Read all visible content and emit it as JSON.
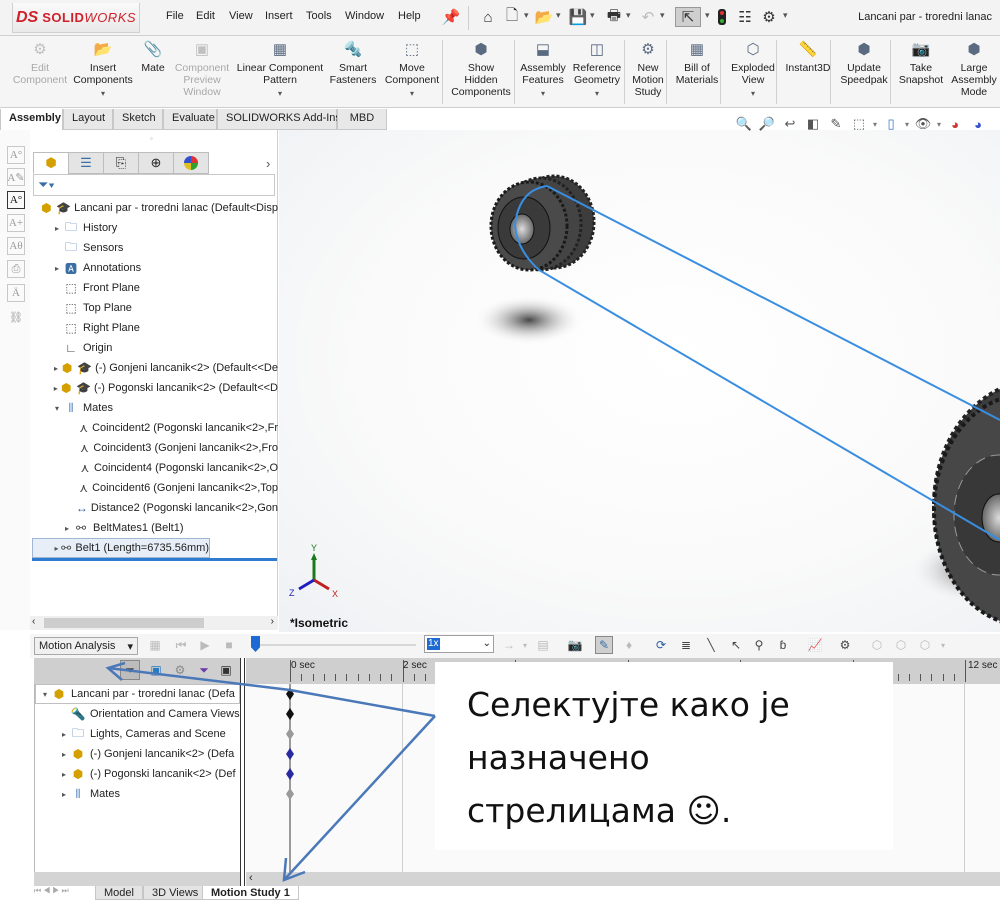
{
  "app": {
    "logo_prefix": "DS",
    "logo_text_bold": "SOLID",
    "logo_text_light": "WORKS",
    "document_title": "Lancani par - troredni lanac"
  },
  "menu": [
    "File",
    "Edit",
    "View",
    "Insert",
    "Tools",
    "Window",
    "Help"
  ],
  "quick_access": {
    "icons": [
      "pin-icon",
      "home-icon",
      "new-document-icon",
      "open-icon",
      "save-icon",
      "print-icon",
      "undo-icon",
      "select-icon",
      "rebuild-traffic-light-icon",
      "file-properties-icon",
      "options-gear-icon"
    ]
  },
  "command_manager": {
    "commands": [
      {
        "label": "Edit\nComponent",
        "icon": "edit-component-icon",
        "disabled": true
      },
      {
        "label": "Insert\nComponents",
        "icon": "insert-components-icon",
        "dropdown": true
      },
      {
        "label": "Mate",
        "icon": "mate-paperclip-icon"
      },
      {
        "label": "Component\nPreview\nWindow",
        "icon": "component-preview-icon",
        "disabled": true
      },
      {
        "label": "Linear Component\nPattern",
        "icon": "linear-pattern-icon",
        "dropdown": true
      },
      {
        "label": "Smart\nFasteners",
        "icon": "smart-fasteners-icon"
      },
      {
        "label": "Move\nComponent",
        "icon": "move-component-icon",
        "dropdown": true
      },
      {
        "label": "Show\nHidden\nComponents",
        "icon": "show-hidden-icon"
      },
      {
        "label": "Assembly\nFeatures",
        "icon": "assembly-features-icon",
        "dropdown": true
      },
      {
        "label": "Reference\nGeometry",
        "icon": "reference-geometry-icon",
        "dropdown": true
      },
      {
        "label": "New\nMotion\nStudy",
        "icon": "motion-study-icon"
      },
      {
        "label": "Bill of\nMaterials",
        "icon": "bom-icon"
      },
      {
        "label": "Exploded\nView",
        "icon": "exploded-view-icon",
        "dropdown": true
      },
      {
        "label": "Instant3D",
        "icon": "instant3d-icon"
      },
      {
        "label": "Update\nSpeedpak",
        "icon": "speedpak-icon"
      },
      {
        "label": "Take\nSnapshot",
        "icon": "camera-icon"
      },
      {
        "label": "Large\nAssembly\nMode",
        "icon": "large-assembly-icon"
      }
    ],
    "tabs": [
      "Assembly",
      "Layout",
      "Sketch",
      "Evaluate",
      "SOLIDWORKS Add-Ins",
      "MBD"
    ],
    "active_tab": "Assembly"
  },
  "feature_manager": {
    "tabs": [
      "featuremanager-tree-icon",
      "propertymanager-icon",
      "configurationmanager-icon",
      "dimxpert-icon",
      "display-manager-icon"
    ],
    "tree": [
      {
        "label": "Lancani par - troredni lanac  (Default<Disp",
        "level": 0,
        "icon": "assembly-icon",
        "expand": ""
      },
      {
        "label": "History",
        "level": 1,
        "icon": "history-folder-icon",
        "expand": "▸"
      },
      {
        "label": "Sensors",
        "level": 1,
        "icon": "sensors-folder-icon",
        "expand": ""
      },
      {
        "label": "Annotations",
        "level": 1,
        "icon": "annotations-folder-icon",
        "expand": "▸"
      },
      {
        "label": "Front Plane",
        "level": 1,
        "icon": "plane-icon",
        "expand": ""
      },
      {
        "label": "Top Plane",
        "level": 1,
        "icon": "plane-icon",
        "expand": ""
      },
      {
        "label": "Right Plane",
        "level": 1,
        "icon": "plane-icon",
        "expand": ""
      },
      {
        "label": "Origin",
        "level": 1,
        "icon": "origin-icon",
        "expand": ""
      },
      {
        "label": "(-) Gonjeni lancanik<2>  (Default<<De",
        "level": 1,
        "icon": "part-icon",
        "expand": "▸"
      },
      {
        "label": "(-) Pogonski lancanik<2>  (Default<<D",
        "level": 1,
        "icon": "part-icon",
        "expand": "▸"
      },
      {
        "label": "Mates",
        "level": 1,
        "icon": "mates-folder-icon",
        "expand": "▾"
      },
      {
        "label": "Coincident2 (Pogonski lancanik<2>,Fr",
        "level": 2,
        "icon": "coincident-mate-icon",
        "expand": ""
      },
      {
        "label": "Coincident3 (Gonjeni lancanik<2>,Fro",
        "level": 2,
        "icon": "coincident-mate-icon",
        "expand": ""
      },
      {
        "label": "Coincident4 (Pogonski lancanik<2>,O",
        "level": 2,
        "icon": "coincident-mate-icon",
        "expand": ""
      },
      {
        "label": "Coincident6 (Gonjeni lancanik<2>,Top",
        "level": 2,
        "icon": "coincident-mate-icon",
        "expand": ""
      },
      {
        "label": "Distance2 (Pogonski lancanik<2>,Gon",
        "level": 2,
        "icon": "distance-mate-icon",
        "expand": ""
      },
      {
        "label": "BeltMates1 (Belt1)",
        "level": 1.5,
        "icon": "belt-mates-icon",
        "expand": "▸"
      },
      {
        "label": "Belt1 (Length=6735.56mm)",
        "level": 1,
        "icon": "belt-icon",
        "expand": "▸",
        "selected": true
      }
    ]
  },
  "graphics": {
    "view_label": "*Isometric",
    "triad": {
      "x": "X",
      "y": "Y",
      "z": "Z"
    },
    "belt_color": "#3a8ee0"
  },
  "motion_study": {
    "study_type": "Motion Analysis",
    "playback_speed": "1x",
    "timeline_labels": [
      "0 sec",
      "2 sec",
      "12 sec"
    ],
    "tree": [
      {
        "label": "Lancani par - troredni lanac  (Defa",
        "icon": "assembly-icon",
        "expand": "▾",
        "level": 0
      },
      {
        "label": "Orientation and Camera Views",
        "icon": "camera-views-icon",
        "expand": "",
        "level": 1
      },
      {
        "label": "Lights, Cameras and Scene",
        "icon": "lights-folder-icon",
        "expand": "▸",
        "level": 1
      },
      {
        "label": "(-) Gonjeni lancanik<2>  (Defa",
        "icon": "part-icon",
        "expand": "▸",
        "level": 1
      },
      {
        "label": "(-) Pogonski lancanik<2>  (Def",
        "icon": "part-icon",
        "expand": "▸",
        "level": 1
      },
      {
        "label": "Mates",
        "icon": "mates-folder-icon",
        "expand": "▸",
        "level": 1
      }
    ],
    "keys": [
      {
        "color": "#111111"
      },
      {
        "color": "#111111"
      },
      {
        "color": "#9a9a9a"
      },
      {
        "color": "#2a2aa0"
      },
      {
        "color": "#2a2aa0"
      },
      {
        "color": "#9a9a9a"
      }
    ],
    "bottom_tabs": [
      "Model",
      "3D Views",
      "Motion Study 1"
    ],
    "active_bottom_tab": "Motion Study 1"
  },
  "annotation": {
    "text_line1": "Селектујте како је",
    "text_line2": "назначено",
    "text_line3": "стрелицама ☺.",
    "arrow_color": "#4a78b8"
  }
}
